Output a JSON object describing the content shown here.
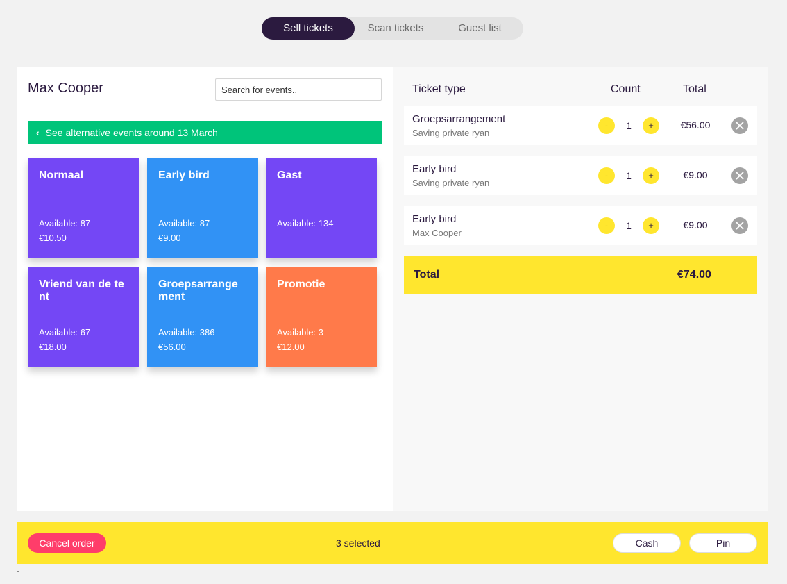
{
  "tabs": [
    "Sell tickets",
    "Scan tickets",
    "Guest list"
  ],
  "event": {
    "title": "Max Cooper",
    "search_placeholder": "Search for events..",
    "alt_events_label": "See alternative events around 13 March"
  },
  "ticket_cards": [
    {
      "name": "Normaal",
      "available": "Available: 87",
      "price": "€10.50",
      "color": "#7447f5"
    },
    {
      "name": "Early bird",
      "available": "Available: 87",
      "price": "€9.00",
      "color": "#3192f5"
    },
    {
      "name": "Gast",
      "available": "Available: 134",
      "price": "",
      "color": "#7447f5"
    },
    {
      "name": "Vriend van de tent",
      "available": "Available: 67",
      "price": "€18.00",
      "color": "#7447f5"
    },
    {
      "name": "Groepsarrangement",
      "available": "Available: 386",
      "price": "€56.00",
      "color": "#3192f5"
    },
    {
      "name": "Promotie",
      "available": "Available: 3",
      "price": "€12.00",
      "color": "#ff7a4a"
    }
  ],
  "order": {
    "headers": {
      "type": "Ticket type",
      "count": "Count",
      "total": "Total"
    },
    "items": [
      {
        "type": "Groepsarrangement",
        "event": "Saving private ryan",
        "count": "1",
        "total": "€56.00"
      },
      {
        "type": "Early bird",
        "event": "Saving private ryan",
        "count": "1",
        "total": "€9.00"
      },
      {
        "type": "Early bird",
        "event": "Max Cooper",
        "count": "1",
        "total": "€9.00"
      }
    ],
    "minus_label": "-",
    "plus_label": "+",
    "total_label": "Total",
    "total_amount": "€74.00"
  },
  "footer": {
    "cancel_label": "Cancel order",
    "selected_text": "3 selected",
    "cash_label": "Cash",
    "pin_label": "Pin"
  },
  "colors": {
    "dark": "#2b1a3f",
    "yellow": "#ffe62e",
    "green": "#00c47a",
    "pink": "#ff3d6a"
  }
}
